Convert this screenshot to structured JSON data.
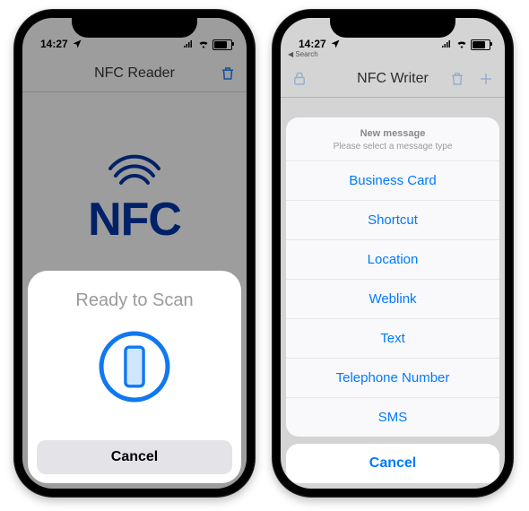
{
  "status_time": "14:27",
  "left_phone": {
    "nav_title": "NFC Reader",
    "logo_text": "NFC",
    "scan_title": "Ready to Scan",
    "cancel_label": "Cancel"
  },
  "right_phone": {
    "back_label": "Search",
    "nav_title": "NFC Writer",
    "sheet_title": "New message",
    "sheet_subtitle": "Please select a message type",
    "options": {
      "o0": "Business Card",
      "o1": "Shortcut",
      "o2": "Location",
      "o3": "Weblink",
      "o4": "Text",
      "o5": "Telephone Number",
      "o6": "SMS"
    },
    "cancel_label": "Cancel"
  }
}
